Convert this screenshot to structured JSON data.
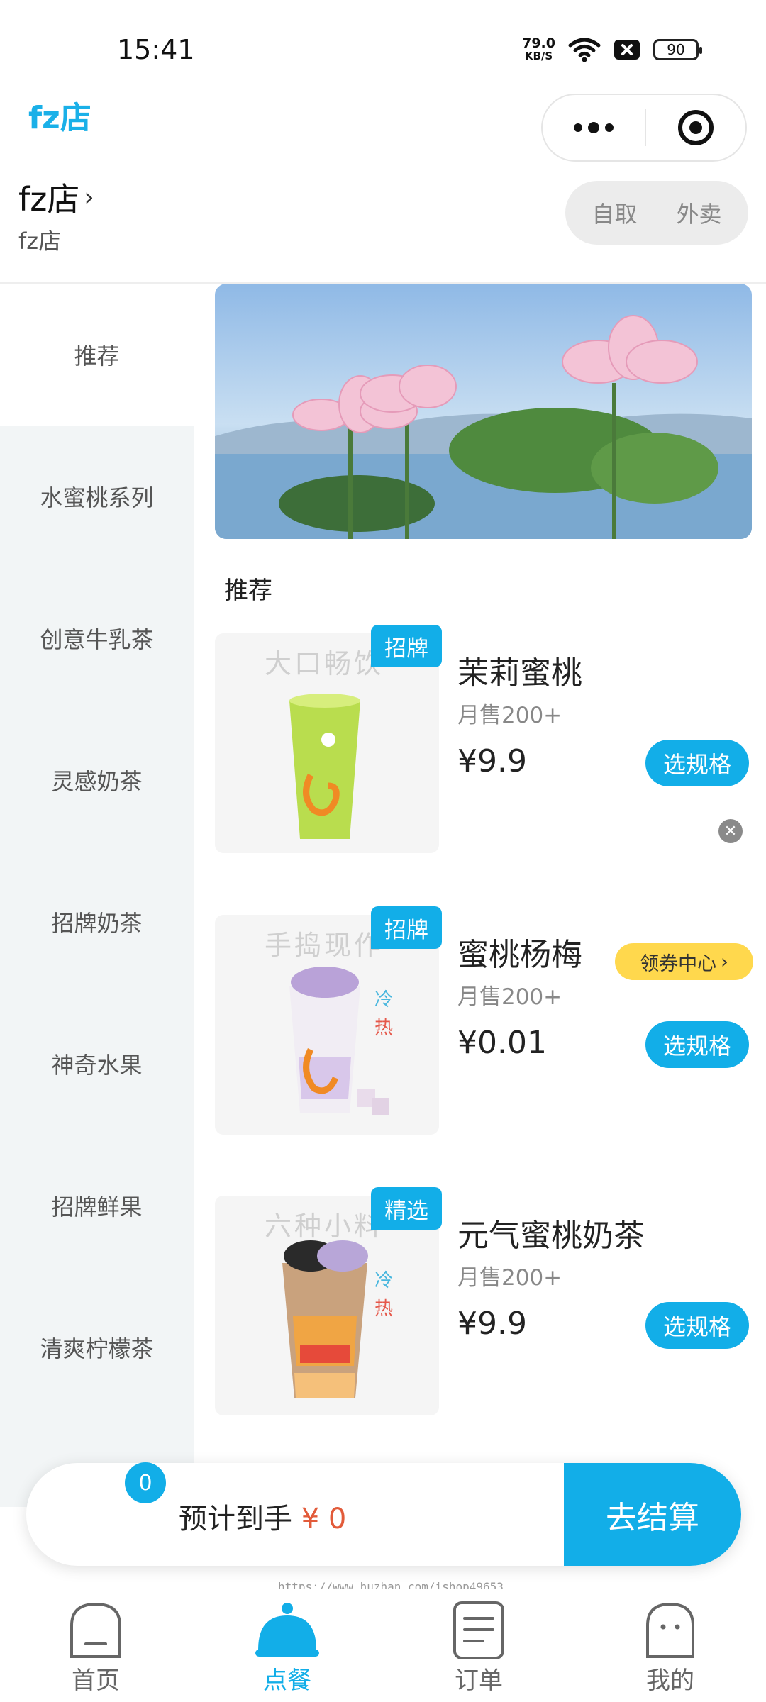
{
  "status_bar": {
    "time": "15:41",
    "speed_value": "79.0",
    "speed_unit": "KB/S",
    "battery": "90"
  },
  "header": {
    "title": "fz店"
  },
  "store": {
    "name": "fz店",
    "subtitle": "fz店",
    "modes": [
      "自取",
      "外卖"
    ]
  },
  "sidebar": {
    "items": [
      {
        "label": "推荐"
      },
      {
        "label": "水蜜桃系列"
      },
      {
        "label": "创意牛乳茶"
      },
      {
        "label": "灵感奶茶"
      },
      {
        "label": "招牌奶茶"
      },
      {
        "label": "神奇水果"
      },
      {
        "label": "招牌鲜果"
      },
      {
        "label": "清爽柠檬茶"
      }
    ]
  },
  "section": {
    "title": "推荐"
  },
  "products": [
    {
      "name": "茉莉蜜桃",
      "sales": "月售200+",
      "price": "¥9.9",
      "badge": "招牌",
      "button": "选规格",
      "image_text": "大口畅饮"
    },
    {
      "name": "蜜桃杨梅",
      "sales": "月售200+",
      "price": "¥0.01",
      "badge": "招牌",
      "button": "选规格",
      "image_text": "手捣现作",
      "cold": "冷",
      "hot": "热"
    },
    {
      "name": "元气蜜桃奶茶",
      "sales": "月售200+",
      "price": "¥9.9",
      "badge": "精选",
      "button": "选规格",
      "image_text": "六种小料",
      "cold": "冷",
      "hot": "热"
    }
  ],
  "coupon": {
    "label": "领券中心"
  },
  "cart": {
    "count": "0",
    "estimate_label": "预计到手",
    "amount": "¥ 0",
    "checkout_label": "去结算"
  },
  "watermark": "https://www.huzhan.com/ishop49653",
  "nav": {
    "items": [
      {
        "label": "首页"
      },
      {
        "label": "点餐"
      },
      {
        "label": "订单"
      },
      {
        "label": "我的"
      }
    ]
  },
  "colors": {
    "accent": "#12aee8",
    "coupon": "#ffd84d",
    "price_highlight": "#e25b3a"
  }
}
